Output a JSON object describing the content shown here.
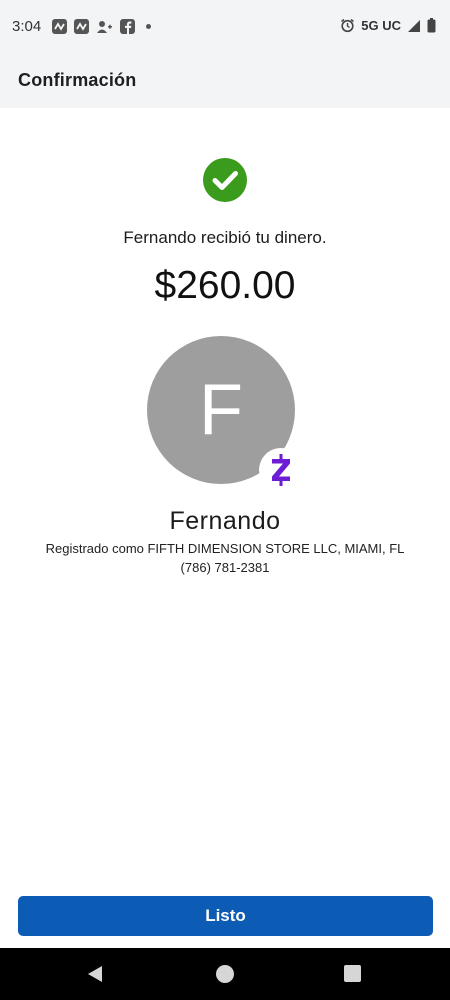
{
  "status_bar": {
    "time": "3:04",
    "network": "5G UC",
    "left_icons": [
      "notification-app-icon",
      "notification-app-icon",
      "add-contact-icon",
      "facebook-icon",
      "dot-icon"
    ],
    "right_icons": [
      "alarm-icon",
      "signal-icon",
      "battery-icon"
    ]
  },
  "header": {
    "title": "Confirmación"
  },
  "confirmation": {
    "message": "Fernando recibió tu dinero.",
    "amount": "$260.00",
    "status_icon": "check-circle-icon",
    "status_color": "#3a9b1c"
  },
  "recipient": {
    "initial": "F",
    "name": "Fernando",
    "registered_as": "Registrado como FIFTH DIMENSION STORE LLC, MIAMI, FL",
    "phone": "(786) 781-2381",
    "avatar_color": "#9e9e9e",
    "badge_icon": "zelle-logo-icon",
    "badge_color": "#6d1ed4"
  },
  "actions": {
    "done_label": "Listo",
    "button_color": "#0c5bb5"
  },
  "nav_bar": {
    "items": [
      "back-icon",
      "home-icon",
      "recents-icon"
    ]
  }
}
